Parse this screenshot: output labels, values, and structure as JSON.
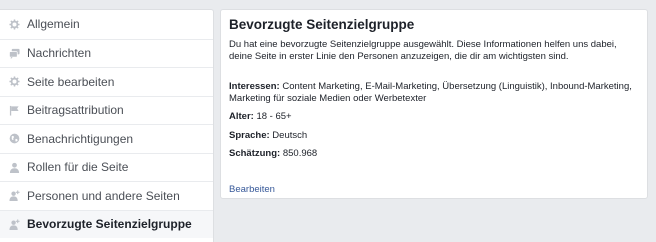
{
  "sidebar": {
    "items": [
      {
        "label": "Allgemein",
        "icon": "gear-icon"
      },
      {
        "label": "Nachrichten",
        "icon": "messages-icon"
      },
      {
        "label": "Seite bearbeiten",
        "icon": "gear-icon"
      },
      {
        "label": "Beitragsattribution",
        "icon": "flag-icon"
      },
      {
        "label": "Benachrichtigungen",
        "icon": "globe-icon"
      },
      {
        "label": "Rollen für die Seite",
        "icon": "person-icon"
      },
      {
        "label": "Personen und andere Seiten",
        "icon": "person-plus-icon"
      },
      {
        "label": "Bevorzugte Seitenzielgruppe",
        "icon": "person-plus-icon",
        "active": true
      }
    ]
  },
  "main": {
    "title": "Bevorzugte Seitenzielgruppe",
    "description": "Du hat eine bevorzugte Seitenzielgruppe ausgewählt. Diese Informationen helfen uns dabei, deine Seite in erster Linie den Personen anzuzeigen, die dir am wichtigsten sind.",
    "interests_label": "Interessen:",
    "interests_value": "Content Marketing, E-Mail-Marketing, Übersetzung (Linguistik), Inbound-Marketing, Marketing für soziale Medien oder Werbetexter",
    "age_label": "Alter:",
    "age_value": "18 - 65+",
    "language_label": "Sprache:",
    "language_value": "Deutsch",
    "estimate_label": "Schätzung:",
    "estimate_value": "850.968",
    "edit_link": "Bearbeiten"
  },
  "colors": {
    "background": "#e9ebee",
    "link": "#365899",
    "text": "#1d2129",
    "sidebar_text": "#4b4f56",
    "icon": "#bec2c9"
  }
}
